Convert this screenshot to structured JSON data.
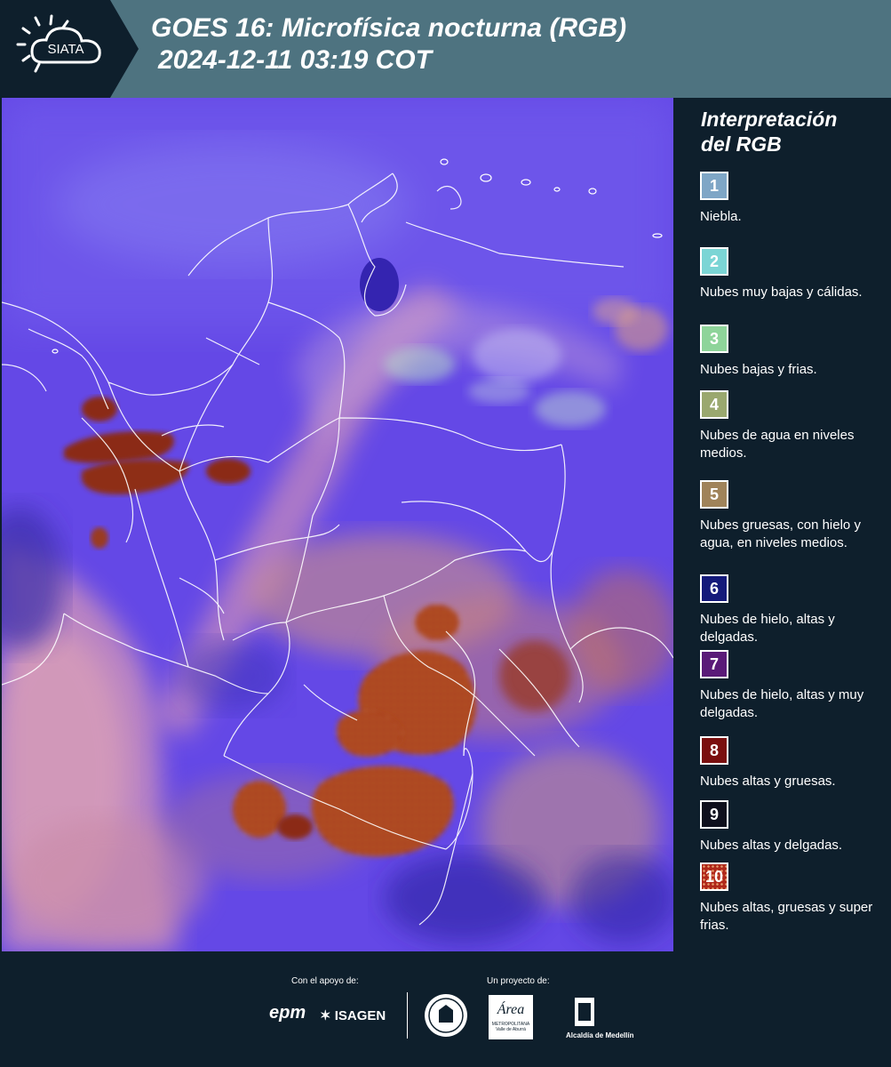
{
  "header": {
    "logo_text": "SIATA",
    "title_line1": "GOES 16: Microfísica nocturna (RGB)",
    "title_line2": "2024-12-11 03:19 COT",
    "background": "#4e7380",
    "logo_background": "#0e1f2c"
  },
  "legend": {
    "title_line1": "Interpretación",
    "title_line2": "del RGB",
    "items": [
      {
        "number": "1",
        "text": "Niebla.",
        "color": "#7fa6c6"
      },
      {
        "number": "2",
        "text": "Nubes muy bajas y cálidas.",
        "color": "#7bd5d5"
      },
      {
        "number": "3",
        "text": "Nubes bajas y frias.",
        "color": "#8ed49a"
      },
      {
        "number": "4",
        "text": "Nubes de agua en niveles medios.",
        "color": "#9aa86f"
      },
      {
        "number": "5",
        "text": "Nubes gruesas, con hielo y agua, en niveles medios.",
        "color": "#a0835a"
      },
      {
        "number": "6",
        "text": "Nubes de hielo, altas y delgadas.",
        "color": "#141a7a"
      },
      {
        "number": "7",
        "text": "Nubes de hielo, altas y muy delgadas.",
        "color": "#5a1a78"
      },
      {
        "number": "8",
        "text": "Nubes altas y gruesas.",
        "color": "#7a0f0f"
      },
      {
        "number": "9",
        "text": "Nubes altas y delgadas.",
        "color": "#0e0f1c"
      },
      {
        "number": "10",
        "text": "Nubes altas, gruesas y super frias.",
        "color": "#b0281a"
      }
    ]
  },
  "footer": {
    "support_label": "Con el apoyo de:",
    "project_label": "Un proyecto de:",
    "sponsors": [
      "epm",
      "ISAGEN"
    ],
    "partners": [
      "Área Metropolitana Valle de Aburrá",
      "Alcaldía de Medellín"
    ],
    "partner_small_text": "METROPOLITANA",
    "partner_small_text2": "Valle de Aburrá",
    "area_text": "Área",
    "alcaldia_text": "Alcaldía de Medellín"
  },
  "colors": {
    "map_base": "#6a4be8",
    "land_boundary": "#ffffff",
    "thick_cloud": "#8b2a14"
  }
}
